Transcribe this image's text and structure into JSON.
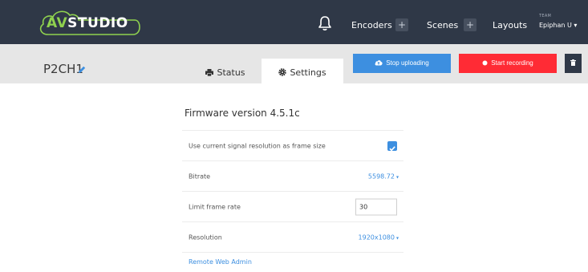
{
  "colors": {
    "navbar": "#2f3847",
    "accent_blue": "#3d8fe0",
    "record_red": "#ff2b35",
    "logo_green": "#8fd14f"
  },
  "navbar": {
    "logo": {
      "prefix": "AV",
      "suffix": "STUDIO"
    },
    "bell_icon": "bell-icon",
    "items": [
      {
        "label": "Encoders",
        "plus": "+"
      },
      {
        "label": "Scenes",
        "plus": "+"
      },
      {
        "label": "Layouts"
      }
    ],
    "team": {
      "label": "TEAM",
      "user": "Epiphan U",
      "caret": "▾"
    }
  },
  "channel": {
    "name": "P2CH1",
    "edit_icon": "pencil-icon",
    "tabs": [
      {
        "label": "Status",
        "icon": "printer-icon",
        "active": false
      },
      {
        "label": "Settings",
        "icon": "gear-icon",
        "active": true
      }
    ],
    "buttons": {
      "stop_uploading": {
        "label": "Stop uploading",
        "icon": "cloud-upload-icon"
      },
      "start_recording": {
        "label": "Start recording",
        "icon": "record-dot-icon"
      },
      "delete": {
        "icon": "trash-icon"
      }
    }
  },
  "settings": {
    "firmware_title": "Firmware version 4.5.1c",
    "rows": {
      "use_signal_resolution": {
        "label": "Use current signal resolution as frame size",
        "checked": true
      },
      "bitrate": {
        "label": "Bitrate",
        "value": "5598.72",
        "caret": "▾"
      },
      "limit_frame_rate": {
        "label": "Limit frame rate",
        "value": "30"
      },
      "resolution": {
        "label": "Resolution",
        "value": "1920x1080",
        "caret": "▾"
      }
    },
    "remote_admin_link": "Remote Web Admin"
  }
}
